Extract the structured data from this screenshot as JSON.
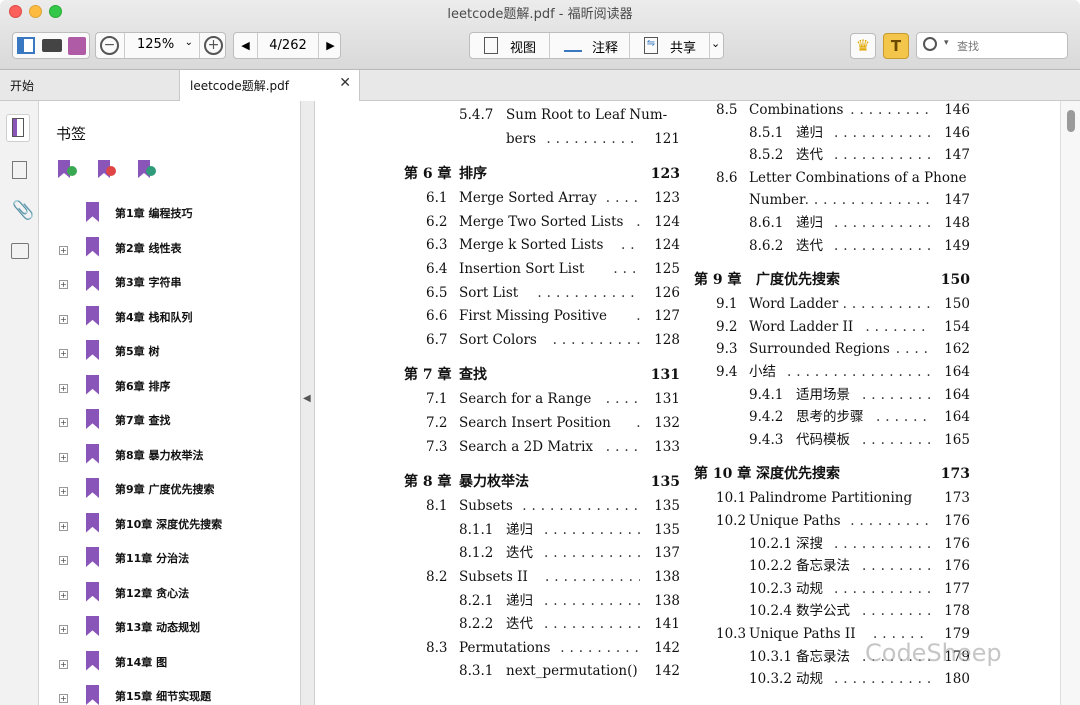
{
  "window": {
    "title": "leetcode题解.pdf - 福昕阅读器"
  },
  "toolbar": {
    "zoom": "125%",
    "page": "4/262",
    "view_label": "视图",
    "annotate_label": "注释",
    "share_label": "共享",
    "search_placeholder": "查找"
  },
  "tabs": [
    {
      "label": "开始"
    },
    {
      "label": "leetcode题解.pdf"
    }
  ],
  "sidebar": {
    "title": "书签",
    "bookmarks": [
      {
        "label": "第1章  编程技巧",
        "expandable": false
      },
      {
        "label": "第2章  线性表",
        "expandable": true
      },
      {
        "label": "第3章  字符串",
        "expandable": true
      },
      {
        "label": "第4章  栈和队列",
        "expandable": true
      },
      {
        "label": "第5章  树",
        "expandable": true
      },
      {
        "label": "第6章  排序",
        "expandable": true
      },
      {
        "label": "第7章  查找",
        "expandable": true
      },
      {
        "label": "第8章  暴力枚举法",
        "expandable": true
      },
      {
        "label": "第9章  广度优先搜索",
        "expandable": true
      },
      {
        "label": "第10章  深度优先搜索",
        "expandable": true
      },
      {
        "label": "第11章  分治法",
        "expandable": true
      },
      {
        "label": "第12章  贪心法",
        "expandable": true
      },
      {
        "label": "第13章  动态规划",
        "expandable": true
      },
      {
        "label": "第14章  图",
        "expandable": true
      },
      {
        "label": "第15章  细节实现题",
        "expandable": true
      }
    ]
  },
  "toc_left": [
    {
      "num": "5.4.7",
      "title": "Sum Root to Leaf Num-",
      "page": "",
      "level": 3
    },
    {
      "num": "",
      "title": "bers",
      "page": "121",
      "level": 3
    },
    {
      "num": "第 6 章",
      "title": "排序",
      "page": "123",
      "level": 0
    },
    {
      "num": "6.1",
      "title": "Merge Sorted Array",
      "page": "123",
      "level": 1
    },
    {
      "num": "6.2",
      "title": "Merge Two Sorted Lists",
      "page": "124",
      "level": 1
    },
    {
      "num": "6.3",
      "title": "Merge k Sorted Lists",
      "page": "124",
      "level": 1
    },
    {
      "num": "6.4",
      "title": "Insertion Sort List",
      "page": "125",
      "level": 1
    },
    {
      "num": "6.5",
      "title": "Sort List",
      "page": "126",
      "level": 1
    },
    {
      "num": "6.6",
      "title": "First Missing Positive",
      "page": "127",
      "level": 1
    },
    {
      "num": "6.7",
      "title": "Sort Colors",
      "page": "128",
      "level": 1
    },
    {
      "num": "第 7 章",
      "title": "查找",
      "page": "131",
      "level": 0
    },
    {
      "num": "7.1",
      "title": "Search for a Range",
      "page": "131",
      "level": 1
    },
    {
      "num": "7.2",
      "title": "Search Insert Position",
      "page": "132",
      "level": 1
    },
    {
      "num": "7.3",
      "title": "Search a 2D Matrix",
      "page": "133",
      "level": 1
    },
    {
      "num": "第 8 章",
      "title": "暴力枚举法",
      "page": "135",
      "level": 0
    },
    {
      "num": "8.1",
      "title": "Subsets",
      "page": "135",
      "level": 1
    },
    {
      "num": "8.1.1",
      "title": "递归",
      "page": "135",
      "level": 2
    },
    {
      "num": "8.1.2",
      "title": "迭代",
      "page": "137",
      "level": 2
    },
    {
      "num": "8.2",
      "title": "Subsets II",
      "page": "138",
      "level": 1
    },
    {
      "num": "8.2.1",
      "title": "递归",
      "page": "138",
      "level": 2
    },
    {
      "num": "8.2.2",
      "title": "迭代",
      "page": "141",
      "level": 2
    },
    {
      "num": "8.3",
      "title": "Permutations",
      "page": "142",
      "level": 1
    },
    {
      "num": "8.3.1",
      "title": "next_permutation()",
      "page": "142",
      "level": 2
    }
  ],
  "toc_right": [
    {
      "num": "8.5",
      "title": "Combinations",
      "page": "146",
      "level": 1
    },
    {
      "num": "8.5.1",
      "title": "递归",
      "page": "146",
      "level": 2
    },
    {
      "num": "8.5.2",
      "title": "迭代",
      "page": "147",
      "level": 2
    },
    {
      "num": "8.6",
      "title": "Letter Combinations of a Phone",
      "page": "",
      "level": 1
    },
    {
      "num": "",
      "title": "Number",
      "page": "147",
      "level": 1
    },
    {
      "num": "8.6.1",
      "title": "递归",
      "page": "148",
      "level": 2
    },
    {
      "num": "8.6.2",
      "title": "迭代",
      "page": "149",
      "level": 2
    },
    {
      "num": "第 9 章",
      "title": "广度优先搜索",
      "page": "150",
      "level": 0
    },
    {
      "num": "9.1",
      "title": "Word Ladder",
      "page": "150",
      "level": 1
    },
    {
      "num": "9.2",
      "title": "Word Ladder II",
      "page": "154",
      "level": 1
    },
    {
      "num": "9.3",
      "title": "Surrounded Regions",
      "page": "162",
      "level": 1
    },
    {
      "num": "9.4",
      "title": "小结",
      "page": "164",
      "level": 1
    },
    {
      "num": "9.4.1",
      "title": "适用场景",
      "page": "164",
      "level": 2
    },
    {
      "num": "9.4.2",
      "title": "思考的步骤",
      "page": "164",
      "level": 2
    },
    {
      "num": "9.4.3",
      "title": "代码模板",
      "page": "165",
      "level": 2
    },
    {
      "num": "第 10 章",
      "title": "深度优先搜索",
      "page": "173",
      "level": 0
    },
    {
      "num": "10.1",
      "title": "Palindrome Partitioning",
      "page": "173",
      "level": 1
    },
    {
      "num": "10.2",
      "title": "Unique Paths",
      "page": "176",
      "level": 1
    },
    {
      "num": "10.2.1",
      "title": "深搜",
      "page": "176",
      "level": 2
    },
    {
      "num": "10.2.2",
      "title": "备忘录法",
      "page": "176",
      "level": 2
    },
    {
      "num": "10.2.3",
      "title": "动规",
      "page": "177",
      "level": 2
    },
    {
      "num": "10.2.4",
      "title": "数学公式",
      "page": "178",
      "level": 2
    },
    {
      "num": "10.3",
      "title": "Unique Paths II",
      "page": "179",
      "level": 1
    },
    {
      "num": "10.3.1",
      "title": "备忘录法",
      "page": "179",
      "level": 2
    },
    {
      "num": "10.3.2",
      "title": "动规",
      "page": "180",
      "level": 2
    }
  ],
  "watermark": "CodeSheep"
}
